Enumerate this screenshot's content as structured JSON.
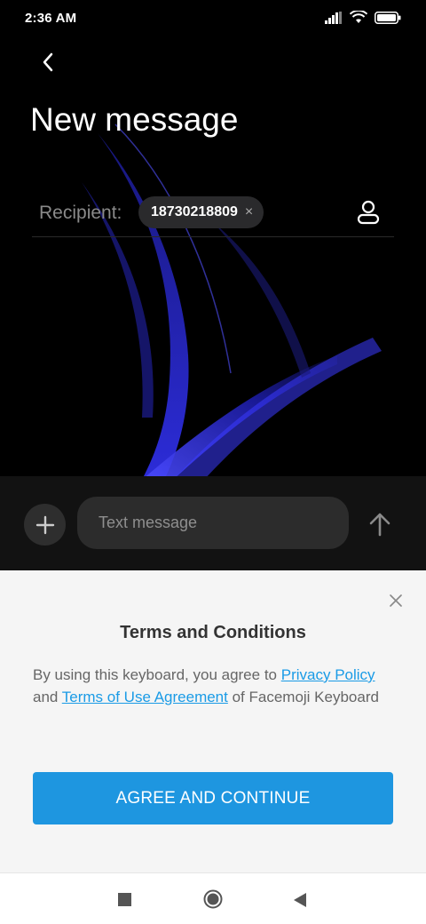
{
  "status_bar": {
    "time": "2:36 AM"
  },
  "header": {
    "title": "New message"
  },
  "recipient": {
    "label": "Recipient:",
    "chip_number": "18730218809",
    "chip_remove_symbol": "×"
  },
  "compose": {
    "placeholder": "Text message"
  },
  "terms": {
    "title": "Terms and Conditions",
    "body_prefix": "By using this keyboard, you agree to ",
    "privacy_link": "Privacy Policy",
    "body_and": " and ",
    "terms_link": "Terms of Use Agreement",
    "body_suffix": " of Facemoji Keyboard",
    "agree_button": "AGREE AND CONTINUE"
  },
  "icons": {
    "back": "chevron-left-icon",
    "contact": "person-icon",
    "attach": "plus-icon",
    "send": "arrow-up-icon",
    "close": "close-icon",
    "signal": "signal-icon",
    "wifi": "wifi-icon",
    "battery": "battery-icon",
    "nav_recents": "square-icon",
    "nav_home": "circle-icon",
    "nav_back": "triangle-back-icon"
  },
  "colors": {
    "accent": "#1e96e0",
    "link": "#1a9be6",
    "sheet_background": "#f5f5f5",
    "app_background": "#000000"
  }
}
